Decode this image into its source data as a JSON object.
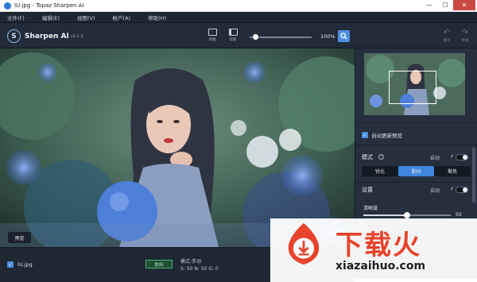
{
  "window": {
    "title": "IU.jpg - Topaz Sharpen AI",
    "minimize": "—",
    "maximize": "☐",
    "close": "✕"
  },
  "menu": [
    "文件(F)",
    "编辑(E)",
    "视图(V)",
    "帐户(A)",
    "帮助(H)"
  ],
  "brand": {
    "logo_letter": "S",
    "name": "Sharpen AI",
    "version": "v2.1.3"
  },
  "toolbar": {
    "single_label": "单图",
    "compare_label": "双图",
    "zoom_value": "100%",
    "zoom_icon": "magnifier-icon",
    "zoom_level": 0.12,
    "undo_label": "撤消",
    "redo_label": "重做"
  },
  "canvas": {
    "preview_label": "预览"
  },
  "panel": {
    "auto_update_label": "自动更新预览",
    "auto_update_checked": true,
    "mode_title": "模式",
    "mode_help": "?",
    "mode_auto_label": "自动",
    "mode_options": [
      "锐化",
      "防抖",
      "聚焦"
    ],
    "mode_selected": "防抖",
    "settings_title": "设置",
    "settings_auto_label": "自动",
    "clarity_label": "清晰度",
    "clarity_value": "50",
    "clarity_level": 0.5,
    "bolt_icon": "⚡"
  },
  "statusbar": {
    "file_name": "IU.jpg",
    "file_checked": true,
    "mode_tag": "防抖",
    "mode_text": "模式:手动",
    "mode_values": "S: 50  N: 50  G: 0"
  },
  "watermark": {
    "big_text": "下载火",
    "url": "xiazaihuo.com"
  },
  "colors": {
    "accent": "#3f86dc",
    "panel": "#262f3d",
    "menubar": "#1e2633",
    "watermark_red": "#e8432b"
  }
}
